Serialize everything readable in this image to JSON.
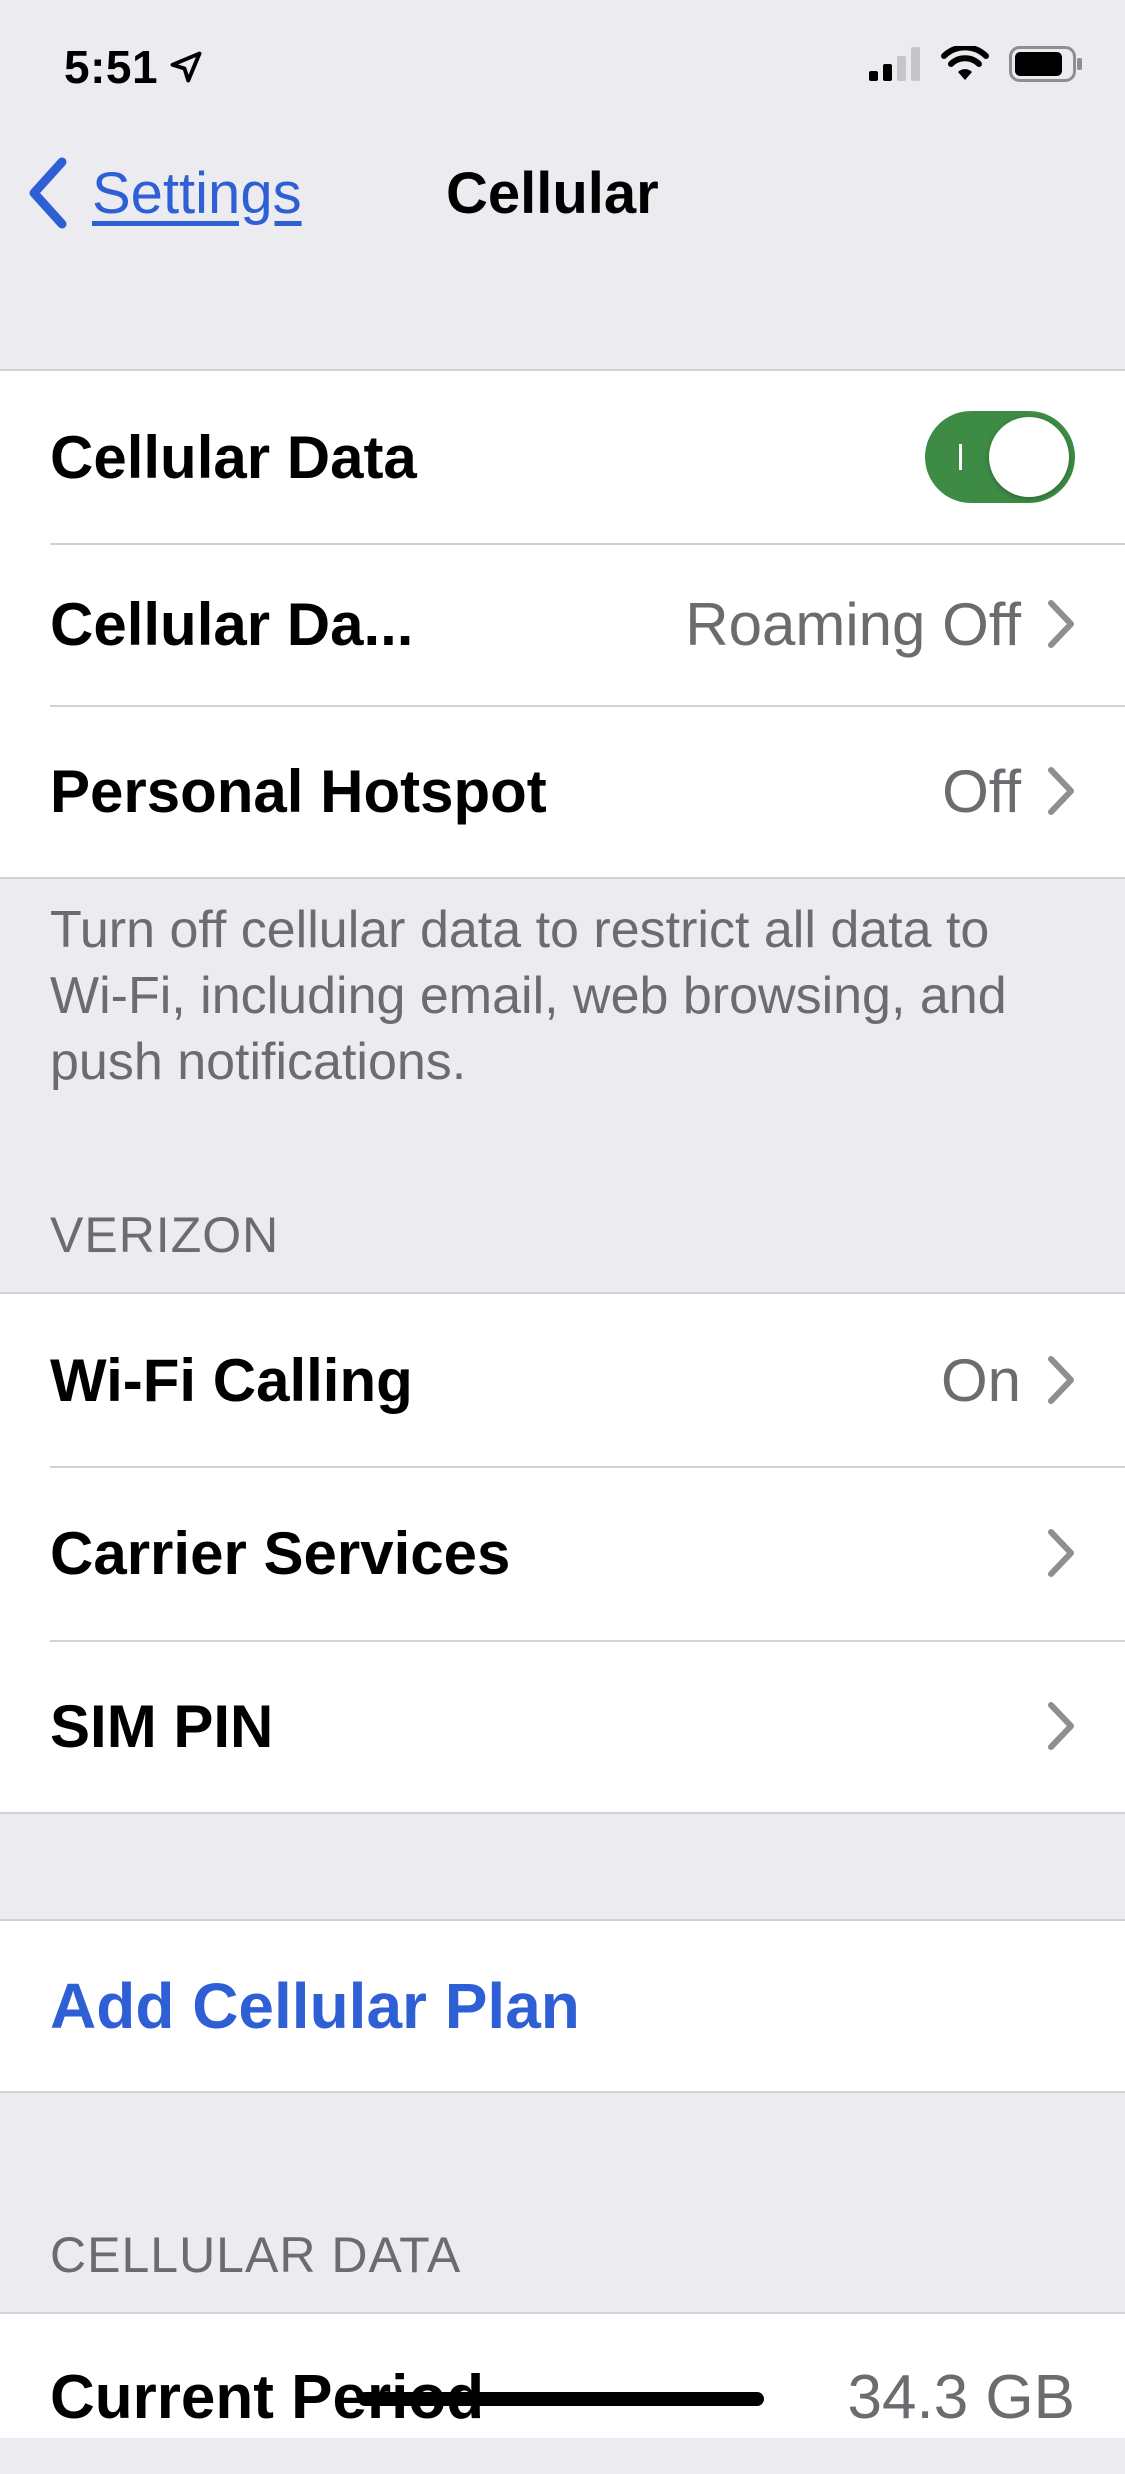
{
  "status_bar": {
    "time": "5:51",
    "location_icon": "location-arrow-icon",
    "signal_icon": "cellular-signal-icon",
    "wifi_icon": "wifi-icon",
    "battery_icon": "battery-icon"
  },
  "nav": {
    "back_label": "Settings",
    "title": "Cellular"
  },
  "group1": {
    "cellular_data_label": "Cellular Data",
    "cellular_data_toggle_on": true,
    "cellular_data_options_label": "Cellular Da...",
    "cellular_data_options_value": "Roaming Off",
    "hotspot_label": "Personal Hotspot",
    "hotspot_value": "Off"
  },
  "group1_footer": "Turn off cellular data to restrict all data to Wi-Fi, including email, web browsing, and push notifications.",
  "carrier_section": {
    "header": "VERIZON",
    "wifi_calling_label": "Wi-Fi Calling",
    "wifi_calling_value": "On",
    "carrier_services_label": "Carrier Services",
    "sim_pin_label": "SIM PIN"
  },
  "add_plan_label": "Add Cellular Plan",
  "data_section": {
    "header": "CELLULAR DATA",
    "current_period_label": "Current Period",
    "current_period_value": "34.3 GB"
  },
  "colors": {
    "accent": "#2f5fd5",
    "toggle_on": "#3d8b45",
    "background": "#ebebf0",
    "secondary_text": "#6b6b70"
  }
}
